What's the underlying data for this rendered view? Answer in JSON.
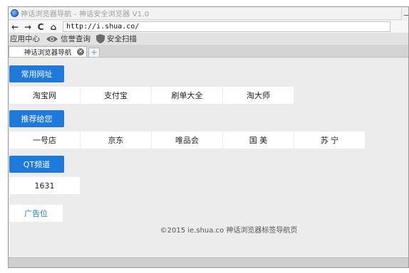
{
  "window": {
    "title": "神话浏览器导航 - 神话安全浏览器 V1.0"
  },
  "nav": {
    "back_glyph": "←",
    "forward_glyph": "→",
    "reload_glyph": "C",
    "home_glyph": "⌂",
    "address": "http://i.shua.co/"
  },
  "toolbar": {
    "app_center": "应用中心",
    "credit_check": "信誉查询",
    "security_scan": "安全扫描"
  },
  "tabs": [
    {
      "label": "神话浏览器导航",
      "active": true
    }
  ],
  "sections": [
    {
      "label": "常用网址",
      "links": [
        "淘宝网",
        "支付宝",
        "刷单大全",
        "淘大师"
      ]
    },
    {
      "label": "推荐给您",
      "links": [
        "一号店",
        "京东",
        "唯品会",
        "国 美",
        "苏 宁"
      ]
    },
    {
      "label": "QT频道",
      "links": [
        "1631"
      ]
    }
  ],
  "ad_label": "广告位",
  "footer": "©2015 ie.shua.co  神话浏览器标签导航页",
  "colors": {
    "accent": "#1e79dc",
    "content_bg": "#ececec"
  }
}
